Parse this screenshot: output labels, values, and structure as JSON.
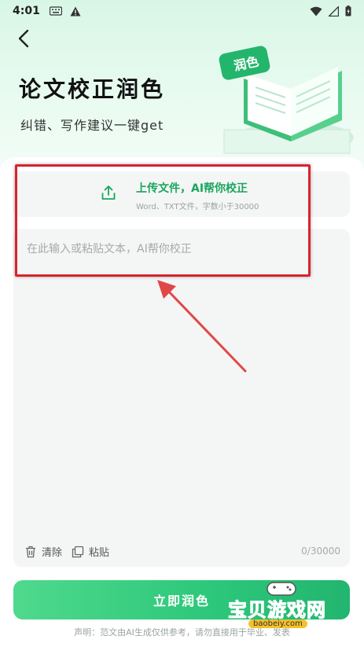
{
  "status_bar": {
    "time": "4:01"
  },
  "hero": {
    "title": "论文校正润色",
    "subtitle": "纠错、写作建议一键get",
    "badge": "润色"
  },
  "upload": {
    "title": "上传文件，AI帮你校正",
    "hint": "Word、TXT文件，字数小于30000"
  },
  "editor": {
    "placeholder": "在此输入或粘贴文本，AI帮你校正",
    "clear_label": "清除",
    "paste_label": "粘贴",
    "counter": "0/30000"
  },
  "submit": {
    "label": "立即润色"
  },
  "disclaimer": "声明：范文由AI生成仅供参考，请勿直接用于毕业、发表",
  "watermark": {
    "text": "宝贝游戏网",
    "url": "baobeiy.com"
  },
  "colors": {
    "accent": "#1aa55d",
    "annotation": "#d9232d",
    "button": "#2cc77a"
  }
}
